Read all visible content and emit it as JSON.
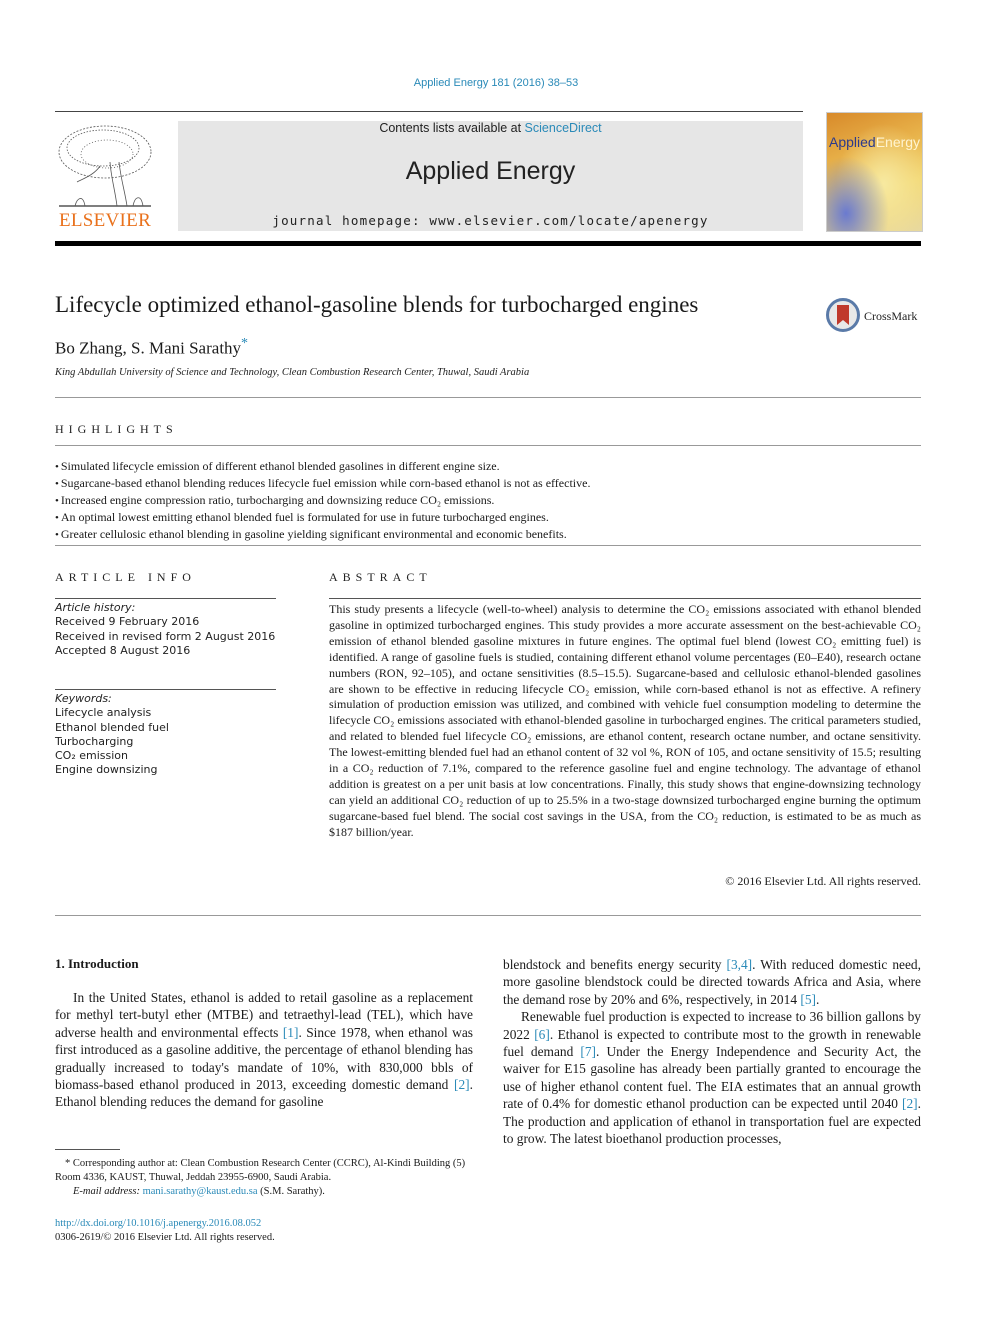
{
  "journal_ref": "Applied Energy 181 (2016) 38–53",
  "masthead": {
    "contents_prefix": "Contents lists available at ",
    "contents_link": "ScienceDirect",
    "journal_title": "Applied Energy",
    "homepage": "journal homepage: www.elsevier.com/locate/apenergy",
    "publisher_logo_text": "ELSEVIER",
    "cover_title_part1": "Applied",
    "cover_title_part2": "Energy"
  },
  "article": {
    "title": "Lifecycle optimized ethanol-gasoline blends for turbocharged engines",
    "authors": "Bo Zhang, S. Mani Sarathy",
    "author_mark": "*",
    "affiliation": "King Abdullah University of Science and Technology, Clean Combustion Research Center, Thuwal, Saudi Arabia",
    "crossmark_label": "CrossMark"
  },
  "highlights": {
    "label": "HIGHLIGHTS",
    "items": [
      "Simulated lifecycle emission of different ethanol blended gasolines in different engine size.",
      "Sugarcane-based ethanol blending reduces lifecycle fuel emission while corn-based ethanol is not as effective.",
      "Increased engine compression ratio, turbocharging and downsizing reduce CO₂ emissions.",
      "An optimal lowest emitting ethanol blended fuel is formulated for use in future turbocharged engines.",
      "Greater cellulosic ethanol blending in gasoline yielding significant environmental and economic benefits."
    ]
  },
  "article_info": {
    "label": "ARTICLE INFO",
    "history_label": "Article history:",
    "history": [
      "Received 9 February 2016",
      "Received in revised form 2 August 2016",
      "Accepted 8 August 2016"
    ],
    "keywords_label": "Keywords:",
    "keywords": [
      "Lifecycle analysis",
      "Ethanol blended fuel",
      "Turbocharging",
      "CO₂ emission",
      "Engine downsizing"
    ]
  },
  "abstract": {
    "label": "ABSTRACT",
    "text": "This study presents a lifecycle (well-to-wheel) analysis to determine the CO₂ emissions associated with ethanol blended gasoline in optimized turbocharged engines. This study provides a more accurate assessment on the best-achievable CO₂ emission of ethanol blended gasoline mixtures in future engines. The optimal fuel blend (lowest CO₂ emitting fuel) is identified. A range of gasoline fuels is studied, containing different ethanol volume percentages (E0–E40), research octane numbers (RON, 92–105), and octane sensitivities (8.5–15.5). Sugarcane-based and cellulosic ethanol-blended gasolines are shown to be effective in reducing lifecycle CO₂ emission, while corn-based ethanol is not as effective. A refinery simulation of production emission was utilized, and combined with vehicle fuel consumption modeling to determine the lifecycle CO₂ emissions associated with ethanol-blended gasoline in turbocharged engines. The critical parameters studied, and related to blended fuel lifecycle CO₂ emissions, are ethanol content, research octane number, and octane sensitivity. The lowest-emitting blended fuel had an ethanol content of 32 vol %, RON of 105, and octane sensitivity of 15.5; resulting in a CO₂ reduction of 7.1%, compared to the reference gasoline fuel and engine technology. The advantage of ethanol addition is greatest on a per unit basis at low concentrations. Finally, this study shows that engine-downsizing technology can yield an additional CO₂ reduction of up to 25.5% in a two-stage downsized turbocharged engine burning the optimum sugarcane-based fuel blend. The social cost savings in the USA, from the CO₂ reduction, is estimated to be as much as $187 billion/year.",
    "copyright": "© 2016 Elsevier Ltd. All rights reserved."
  },
  "introduction": {
    "heading": "1. Introduction",
    "left_column": {
      "p1_a": "In the United States, ethanol is added to retail gasoline as a replacement for methyl tert-butyl ether (MTBE) and tetraethyl-lead (TEL), which have adverse health and environmental effects ",
      "ref1": "[1]",
      "p1_b": ". Since 1978, when ethanol was first introduced as a gasoline additive, the percentage of ethanol blending has gradually increased to today's mandate of 10%, with 830,000 bbls of biomass-based ethanol produced in 2013, exceeding domestic demand ",
      "ref2": "[2]",
      "p1_c": ". Ethanol blending reduces the demand for gasoline"
    },
    "right_column": {
      "p1_a": "blendstock and benefits energy security ",
      "ref34": "[3,4]",
      "p1_b": ". With reduced domestic need, more gasoline blendstock could be directed towards Africa and Asia, where the demand rose by 20% and 6%, respectively, in 2014 ",
      "ref5": "[5]",
      "p1_c": ".",
      "p2_a": "Renewable fuel production is expected to increase to 36 billion gallons by 2022 ",
      "ref6": "[6]",
      "p2_b": ". Ethanol is expected to contribute most to the growth in renewable fuel demand ",
      "ref7": "[7]",
      "p2_c": ". Under the Energy Independence and Security Act, the waiver for E15 gasoline has already been partially granted to encourage the use of higher ethanol content fuel. The EIA estimates that an annual growth rate of 0.4% for domestic ethanol production can be expected until 2040 ",
      "ref2": "[2]",
      "p2_d": ". The production and application of ethanol in transportation fuel are expected to grow. The latest bioethanol production processes,"
    }
  },
  "footnote": {
    "corresponding": "* Corresponding author at: Clean Combustion Research Center (CCRC), Al-Kindi Building (5) Room 4336, KAUST, Thuwal, Jeddah 23955-6900, Saudi Arabia.",
    "email_label": "E-mail address: ",
    "email": "mani.sarathy@kaust.edu.sa",
    "email_suffix": " (S.M. Sarathy)."
  },
  "doi": {
    "link": "http://dx.doi.org/10.1016/j.apenergy.2016.08.052",
    "issn_line": "0306-2619/© 2016 Elsevier Ltd. All rights reserved."
  }
}
